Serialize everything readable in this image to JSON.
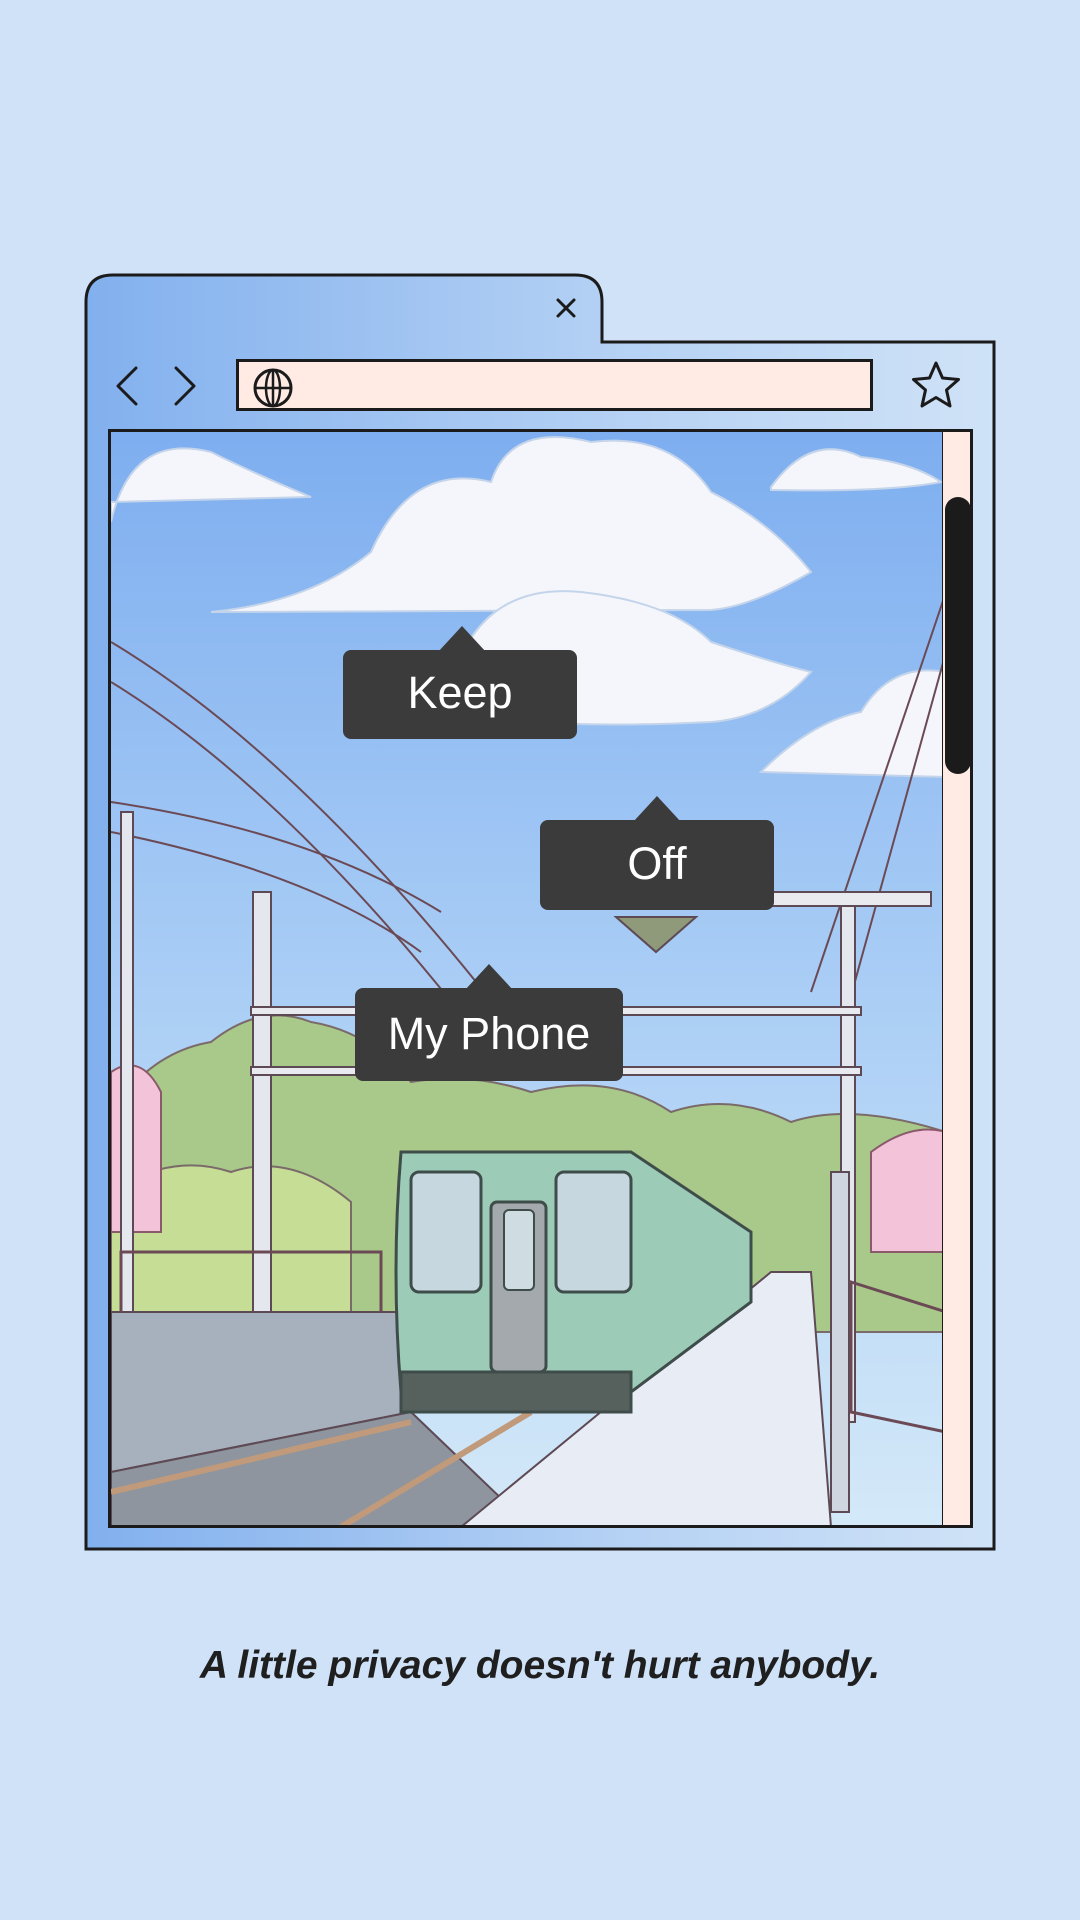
{
  "browser": {
    "tab": {
      "close_icon": "close-icon"
    },
    "toolbar": {
      "back_icon": "chevron-left-icon",
      "forward_icon": "chevron-right-icon",
      "address_icon": "globe-icon",
      "address_value": "",
      "bookmark_icon": "star-icon"
    }
  },
  "tooltips": {
    "keep": "Keep",
    "off": "Off",
    "phone": "My Phone"
  },
  "tagline": "A little privacy doesn't hurt anybody.",
  "colors": {
    "page_background": "#cfe2f7",
    "tab_gradient_start": "#82b0ee",
    "address_bar": "#ffeae4",
    "tooltip": "#3b3b3b",
    "outline": "#1b1b1b"
  }
}
